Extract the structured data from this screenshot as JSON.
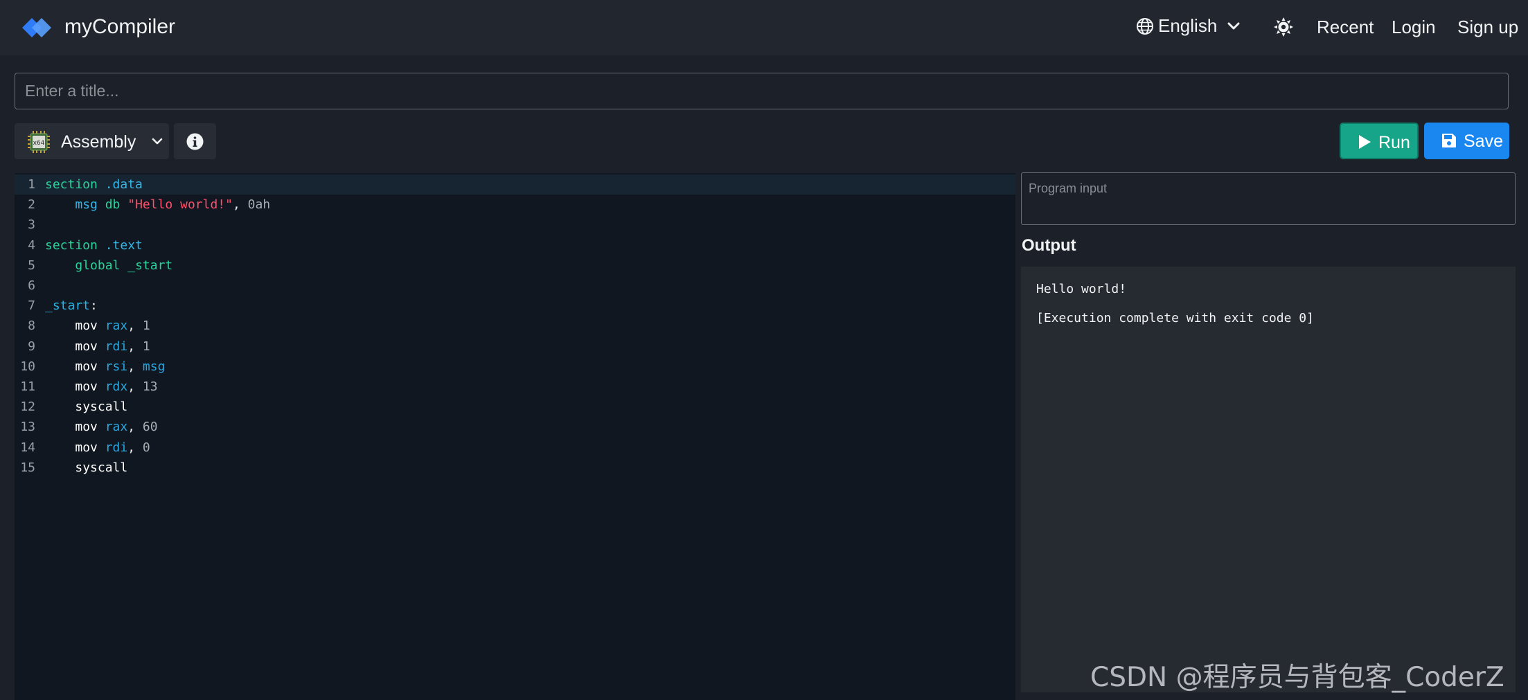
{
  "navbar": {
    "brand": "myCompiler",
    "language": "English",
    "links": {
      "recent": "Recent",
      "login": "Login",
      "signup": "Sign up"
    }
  },
  "title_input": {
    "placeholder": "Enter a title...",
    "value": ""
  },
  "toolbar": {
    "language_label": "Assembly",
    "language_chip_text": "x64",
    "run_label": "Run",
    "save_label": "Save"
  },
  "editor": {
    "lines": [
      {
        "n": "1",
        "tokens": [
          {
            "t": "section",
            "c": "k-sec"
          },
          {
            "t": " "
          },
          {
            "t": ".data",
            "c": "k-dir"
          }
        ]
      },
      {
        "n": "2",
        "tokens": [
          {
            "t": "    "
          },
          {
            "t": "msg",
            "c": "k-dir"
          },
          {
            "t": " "
          },
          {
            "t": "db",
            "c": "k-sec"
          },
          {
            "t": " "
          },
          {
            "t": "\"Hello world!\"",
            "c": "k-str"
          },
          {
            "t": ", "
          },
          {
            "t": "0ah",
            "c": "k-num"
          }
        ]
      },
      {
        "n": "3",
        "tokens": []
      },
      {
        "n": "4",
        "tokens": [
          {
            "t": "section",
            "c": "k-sec"
          },
          {
            "t": " "
          },
          {
            "t": ".text",
            "c": "k-dir"
          }
        ]
      },
      {
        "n": "5",
        "tokens": [
          {
            "t": "    "
          },
          {
            "t": "global",
            "c": "k-glob"
          },
          {
            "t": " "
          },
          {
            "t": "_start",
            "c": "k-glob"
          }
        ]
      },
      {
        "n": "6",
        "tokens": []
      },
      {
        "n": "7",
        "tokens": [
          {
            "t": "_start",
            "c": "k-lab"
          },
          {
            "t": ":"
          }
        ]
      },
      {
        "n": "8",
        "tokens": [
          {
            "t": "    "
          },
          {
            "t": "mov",
            "c": "k-ins"
          },
          {
            "t": " "
          },
          {
            "t": "rax",
            "c": "k-reg"
          },
          {
            "t": ", "
          },
          {
            "t": "1",
            "c": "k-num"
          }
        ]
      },
      {
        "n": "9",
        "tokens": [
          {
            "t": "    "
          },
          {
            "t": "mov",
            "c": "k-ins"
          },
          {
            "t": " "
          },
          {
            "t": "rdi",
            "c": "k-reg"
          },
          {
            "t": ", "
          },
          {
            "t": "1",
            "c": "k-num"
          }
        ]
      },
      {
        "n": "10",
        "tokens": [
          {
            "t": "    "
          },
          {
            "t": "mov",
            "c": "k-ins"
          },
          {
            "t": " "
          },
          {
            "t": "rsi",
            "c": "k-reg"
          },
          {
            "t": ", "
          },
          {
            "t": "msg",
            "c": "k-reg"
          }
        ]
      },
      {
        "n": "11",
        "tokens": [
          {
            "t": "    "
          },
          {
            "t": "mov",
            "c": "k-ins"
          },
          {
            "t": " "
          },
          {
            "t": "rdx",
            "c": "k-reg"
          },
          {
            "t": ", "
          },
          {
            "t": "13",
            "c": "k-num"
          }
        ]
      },
      {
        "n": "12",
        "tokens": [
          {
            "t": "    "
          },
          {
            "t": "syscall",
            "c": "k-ins"
          }
        ]
      },
      {
        "n": "13",
        "tokens": [
          {
            "t": "    "
          },
          {
            "t": "mov",
            "c": "k-ins"
          },
          {
            "t": " "
          },
          {
            "t": "rax",
            "c": "k-reg"
          },
          {
            "t": ", "
          },
          {
            "t": "60",
            "c": "k-num"
          }
        ]
      },
      {
        "n": "14",
        "tokens": [
          {
            "t": "    "
          },
          {
            "t": "mov",
            "c": "k-ins"
          },
          {
            "t": " "
          },
          {
            "t": "rdi",
            "c": "k-reg"
          },
          {
            "t": ", "
          },
          {
            "t": "0",
            "c": "k-num"
          }
        ]
      },
      {
        "n": "15",
        "tokens": [
          {
            "t": "    "
          },
          {
            "t": "syscall",
            "c": "k-ins"
          }
        ]
      }
    ]
  },
  "program_input": {
    "placeholder": "Program input",
    "value": ""
  },
  "output": {
    "heading": "Output",
    "text": "Hello world!\n\n[Execution complete with exit code 0]"
  },
  "watermark": "CSDN @程序员与背包客_CoderZ",
  "colors": {
    "run": "#17a58a",
    "save": "#1a87f0",
    "navbar": "#22272f"
  }
}
